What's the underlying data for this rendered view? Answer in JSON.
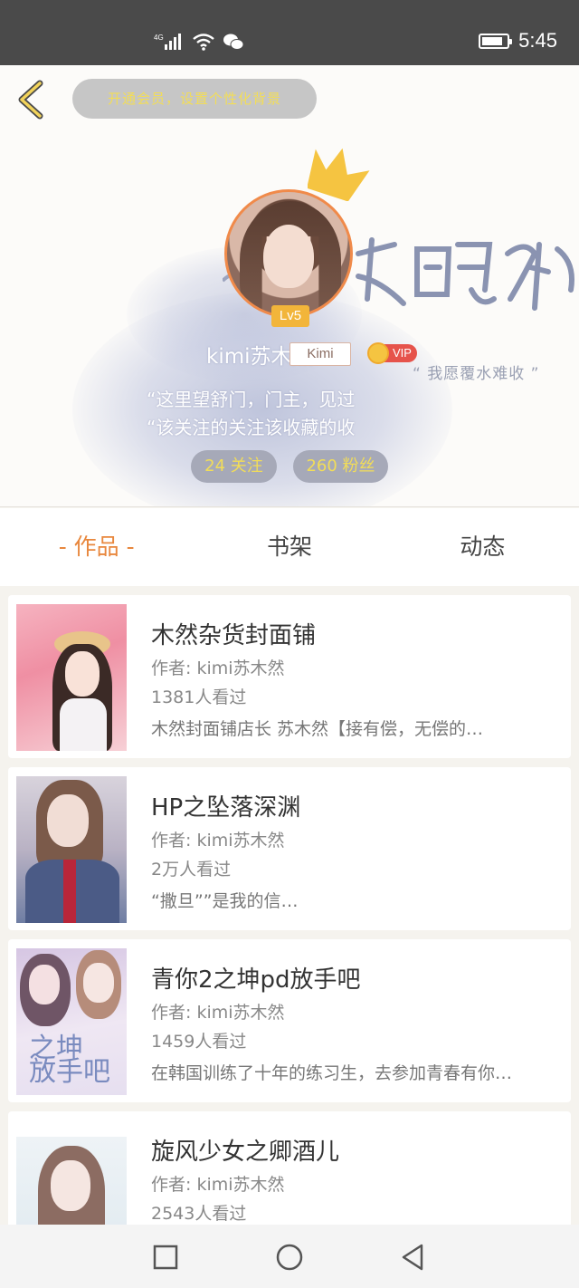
{
  "status_bar": {
    "network": "4G",
    "time": "5:45"
  },
  "header": {
    "vip_banner": "开通会员，设置个性化背景",
    "motto": "“ 我愿覆水难收 ”"
  },
  "profile": {
    "level": "Lv5",
    "username": "kimi苏木然",
    "tag": "Kimi",
    "vip": "VIP",
    "bio_line1": "“这里望舒门，门主，见过",
    "bio_line2": "“该关注的关注该收藏的收",
    "following": "24 关注",
    "fans": "260 粉丝"
  },
  "tabs": [
    {
      "label": "- 作品 -",
      "active": true
    },
    {
      "label": "书架",
      "active": false
    },
    {
      "label": "动态",
      "active": false
    }
  ],
  "works": [
    {
      "title": "木然杂货封面铺",
      "author": "作者: kimi苏木然",
      "views": "1381人看过",
      "desc": "木然封面铺店长  苏木然【接有偿，无偿的…"
    },
    {
      "title": "HP之坠落深渊",
      "author": "作者: kimi苏木然",
      "views": "2万人看过",
      "desc": "“撒旦””是我的信…"
    },
    {
      "title": "青你2之坤pd放手吧",
      "author": "作者: kimi苏木然",
      "views": "1459人看过",
      "desc": "在韩国训练了十年的练习生，去参加青春有你…"
    },
    {
      "title": "旋风少女之卿酒儿",
      "author": "作者: kimi苏木然",
      "views": "2543人看过",
      "desc": ""
    }
  ],
  "colors": {
    "accent": "#e8873d",
    "status_bar": "#4a4a4a",
    "stat_text": "#f2dd58"
  }
}
